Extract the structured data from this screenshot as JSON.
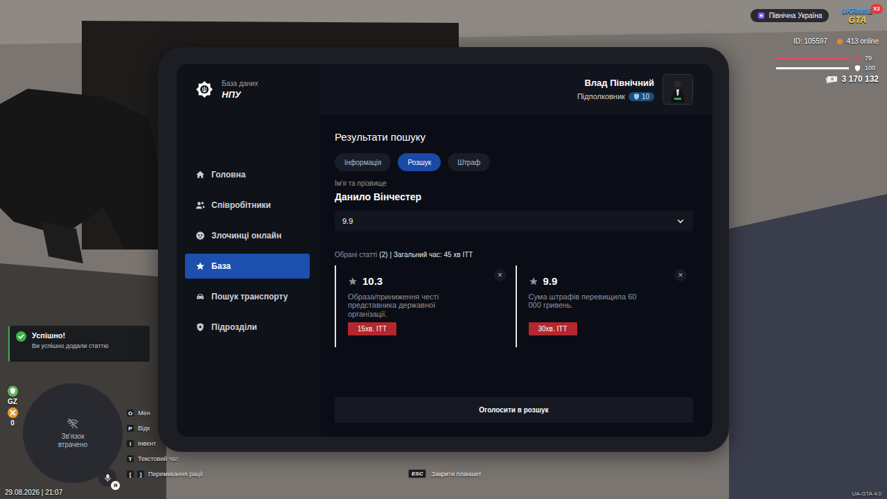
{
  "hud": {
    "server": "Північна Україна",
    "logo": {
      "top": "UKRAINE",
      "bottom": "GTA",
      "badge": "X2"
    },
    "player_id": "ID: 105597",
    "online": "413 online",
    "health": {
      "value": "79",
      "level": 1
    },
    "armor": {
      "value": "100",
      "level": 1
    },
    "money": "3 170 132"
  },
  "notification": {
    "title": "Успішно!",
    "message": "Ви успішно додали статтю"
  },
  "status_icons": [
    {
      "label": "GZ",
      "color": "#5cb85c"
    },
    {
      "label": "0",
      "color": "#e8962e"
    }
  ],
  "minimap": {
    "status": "Зв'язок втрачено"
  },
  "voice": {
    "badge": "Я"
  },
  "keybinds": [
    {
      "keys": [
        "O"
      ],
      "label": "Мен"
    },
    {
      "keys": [
        "P"
      ],
      "label": "Відк"
    },
    {
      "keys": [
        "I"
      ],
      "label": "Інвент"
    },
    {
      "keys": [
        "T"
      ],
      "label": "Текстовий чат"
    },
    {
      "keys": [
        "[",
        "]"
      ],
      "label": "Перемикання рації"
    }
  ],
  "datetime": "29.08.2026 | 21:07",
  "close_hint": {
    "key": "ESC",
    "label": "Закрити планшет"
  },
  "version": "UA-GTA 4.0",
  "tablet": {
    "brand": {
      "subtitle": "База даних",
      "title": "НПУ"
    },
    "user": {
      "name": "Влад Північний",
      "rank": "Підполковник",
      "level": "10"
    },
    "sidebar": [
      {
        "label": "Головна",
        "selected": false
      },
      {
        "label": "Співробітники",
        "selected": false
      },
      {
        "label": "Злочинці онлайн",
        "selected": false
      },
      {
        "label": "База",
        "selected": true
      },
      {
        "label": "Пошук транспорту",
        "selected": false
      },
      {
        "label": "Підрозділи",
        "selected": false
      }
    ],
    "page": {
      "title": "Результати пошуку",
      "tabs": [
        {
          "label": "Інформація",
          "selected": false
        },
        {
          "label": "Розшук",
          "selected": true
        },
        {
          "label": "Штраф",
          "selected": false
        }
      ],
      "name_label": "Ім'я та прізвище",
      "name": "Данило Вінчестер",
      "article_select": "9.9",
      "summary": {
        "label": "Обрані статті",
        "count": "(2)",
        "total": "| Загальний час: 45 хв ІТТ"
      },
      "articles": [
        {
          "code": "10.3",
          "description": "Образа/приниження честі представника державної організації.",
          "time": "15хв. ІТТ",
          "close": "×"
        },
        {
          "code": "9.9",
          "description": "Сума штрафів перевищила 60 000 гривень.",
          "time": "30хв. ІТТ",
          "close": "×"
        }
      ],
      "submit": "Оголосити в розшук"
    }
  }
}
